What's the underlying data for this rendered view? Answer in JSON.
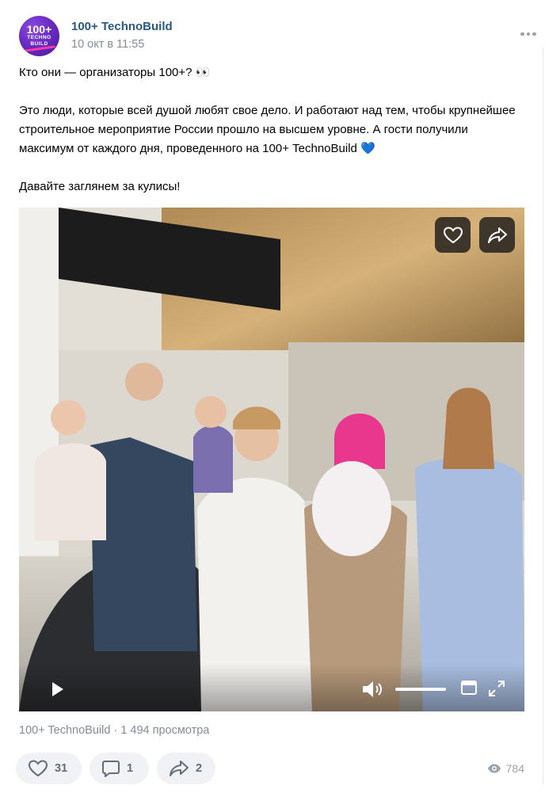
{
  "post": {
    "author": "100+ TechnoBuild",
    "date": "10 окт в 11:55",
    "avatar": {
      "line1": "100+",
      "line2": "TECHNO",
      "line3": "BUILD"
    },
    "text": {
      "p1": "Кто они — организаторы 100+? 👀",
      "p2": "Это люди, которые всей душой любят свое дело. И работают над тем, чтобы крупнейшее строительное мероприятие России прошло на высшем уровне. А гости получили максимум от каждого дня, проведенного на 100+ TechnoBuild 💙",
      "p3": "Давайте заглянем за кулисы!"
    },
    "video": {
      "like_icon": "heart-icon",
      "share_icon": "share-arrow-icon",
      "controls": [
        "play-icon",
        "volume-icon",
        "miniplayer-icon",
        "fullscreen-icon"
      ],
      "volume_level": 1.0
    },
    "source": "100+ TechnoBuild",
    "views_text": " · 1 494 просмотра",
    "actions": {
      "likes": "31",
      "comments": "1",
      "shares": "2"
    },
    "views_count": "784"
  },
  "colors": {
    "link": "#2a5885",
    "secondary": "#818c99",
    "button_bg": "#f0f2f5",
    "icon_gray": "#99a2ad"
  }
}
